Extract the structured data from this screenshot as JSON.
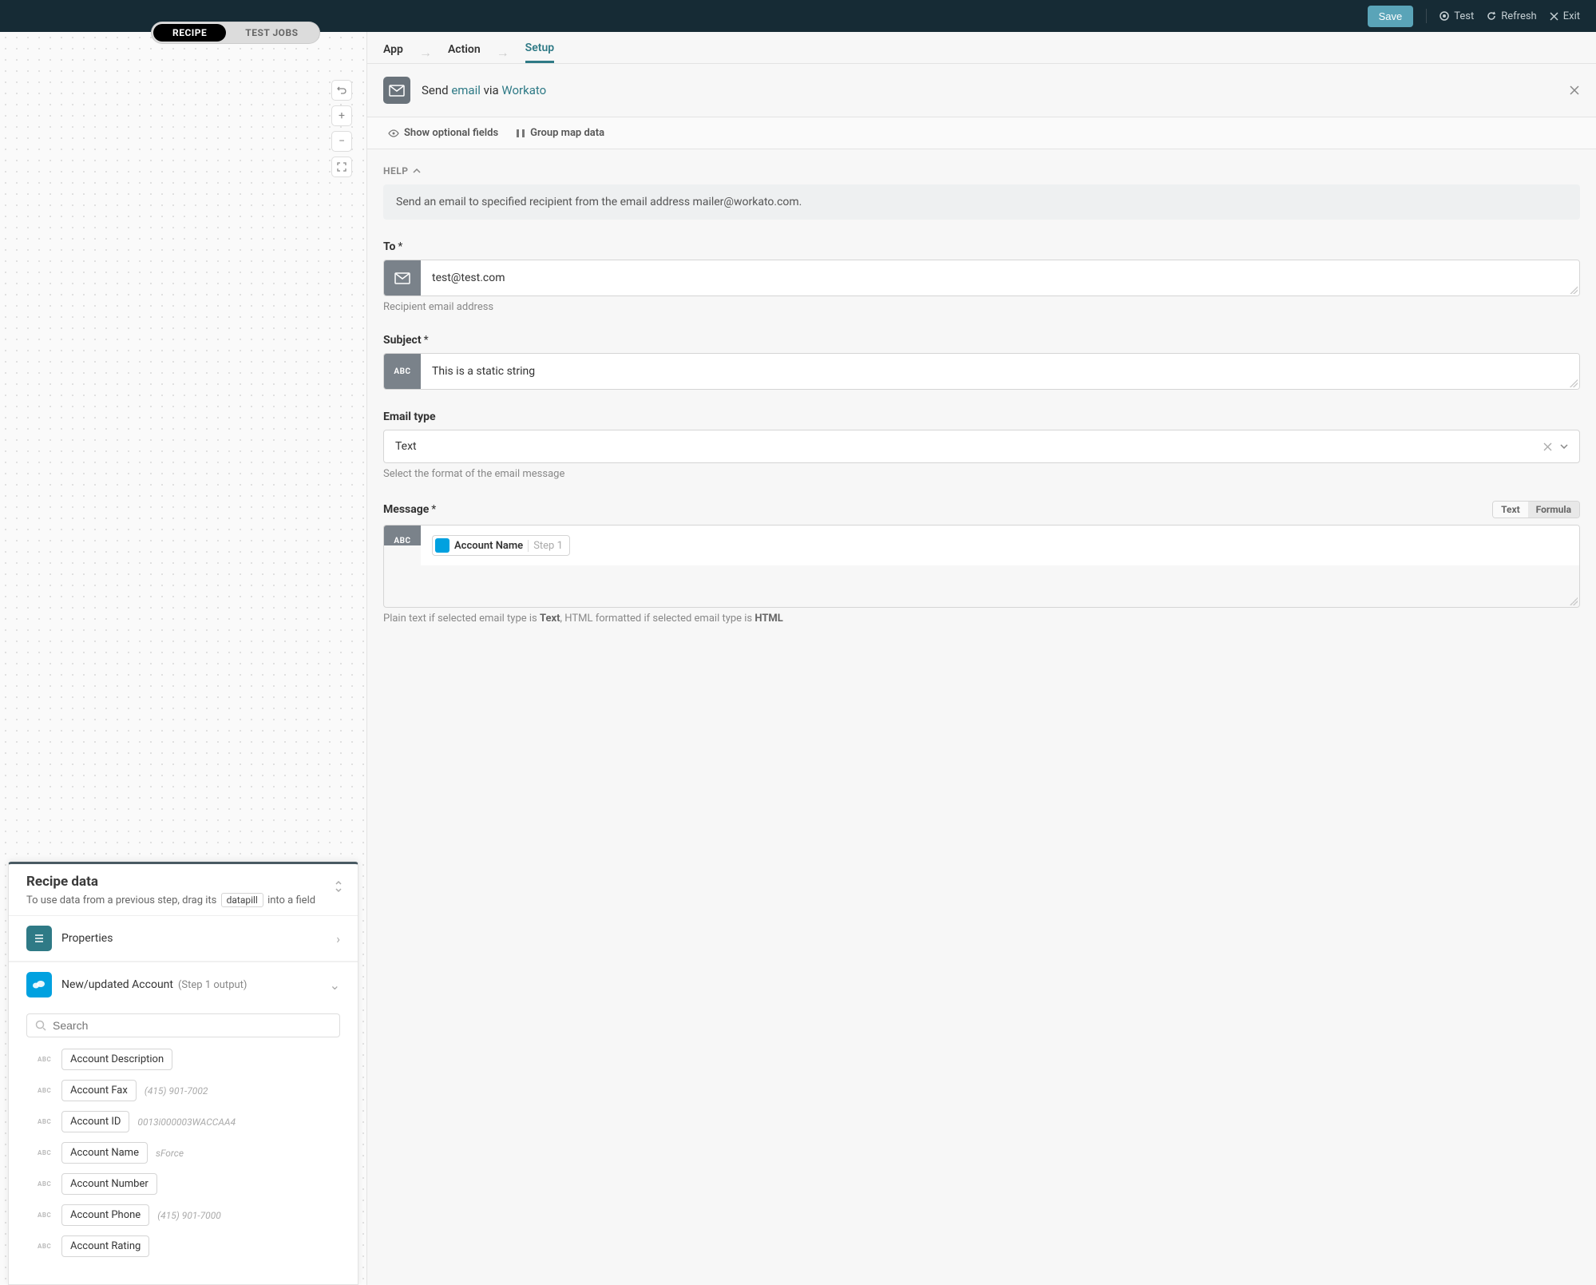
{
  "topbar": {
    "save": "Save",
    "test": "Test",
    "refresh": "Refresh",
    "exit": "Exit"
  },
  "tabs": {
    "recipe": "RECIPE",
    "test_jobs": "TEST JOBS"
  },
  "breadcrumbs": {
    "app": "App",
    "action": "Action",
    "setup": "Setup"
  },
  "action_header": {
    "prefix": "Send ",
    "link1": "email",
    "mid": " via ",
    "link2": "Workato"
  },
  "options": {
    "show_optional": "Show optional fields",
    "group_map": "Group map data"
  },
  "help": {
    "label": "HELP",
    "text": "Send an email to specified recipient from the email address mailer@workato.com."
  },
  "fields": {
    "to": {
      "label": "To",
      "value": "test@test.com",
      "hint": "Recipient email address"
    },
    "subject": {
      "label": "Subject",
      "value": "This is a static string",
      "prefix": "ABC"
    },
    "email_type": {
      "label": "Email type",
      "value": "Text",
      "hint": "Select the format of the email message"
    },
    "message": {
      "label": "Message",
      "prefix": "ABC",
      "toggle_text": "Text",
      "toggle_formula": "Formula",
      "chip_name": "Account Name",
      "chip_step": "Step 1",
      "hint_pre": "Plain text if selected email type is ",
      "hint_b1": "Text",
      "hint_mid": ", HTML formatted if selected email type is ",
      "hint_b2": "HTML"
    }
  },
  "recipe_data": {
    "title": "Recipe data",
    "subtitle_pre": "To use data from a previous step, drag its ",
    "subtitle_pill": "datapill",
    "subtitle_post": " into a field",
    "properties": "Properties",
    "step": {
      "name": "New/updated Account",
      "meta": "(Step 1 output)"
    },
    "search_placeholder": "Search",
    "fields": [
      {
        "type": "ABC",
        "name": "Account Description",
        "sample": ""
      },
      {
        "type": "ABC",
        "name": "Account Fax",
        "sample": "(415) 901-7002"
      },
      {
        "type": "ABC",
        "name": "Account ID",
        "sample": "0013i000003WACCAA4"
      },
      {
        "type": "ABC",
        "name": "Account Name",
        "sample": "sForce"
      },
      {
        "type": "ABC",
        "name": "Account Number",
        "sample": ""
      },
      {
        "type": "ABC",
        "name": "Account Phone",
        "sample": "(415) 901-7000"
      },
      {
        "type": "ABC",
        "name": "Account Rating",
        "sample": ""
      }
    ]
  }
}
